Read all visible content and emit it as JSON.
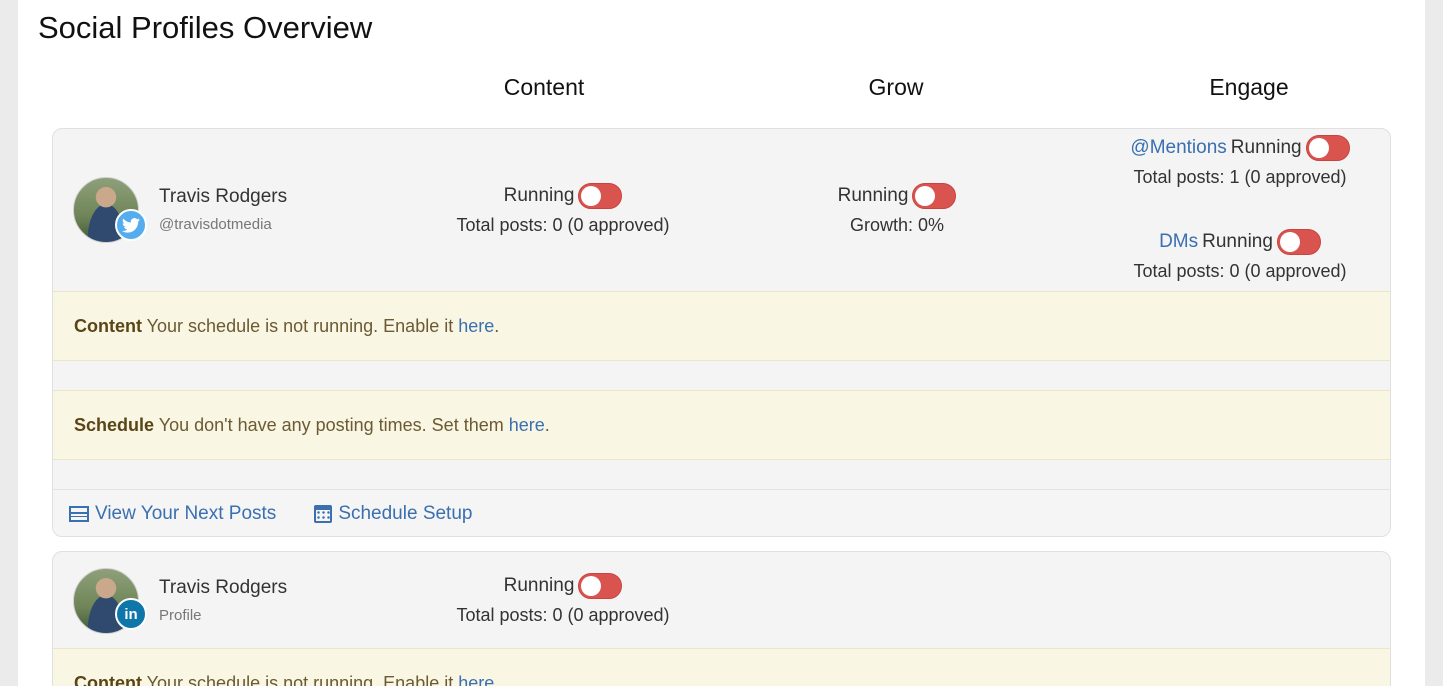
{
  "page": {
    "title": "Social Profiles Overview"
  },
  "columns": {
    "content": "Content",
    "grow": "Grow",
    "engage": "Engage"
  },
  "profiles": [
    {
      "name": "Travis Rodgers",
      "handle": "@travisdotmedia",
      "network_icon": "twitter-icon",
      "content": {
        "status": "Running",
        "posts": "Total posts: 0 (0 approved)"
      },
      "grow": {
        "status": "Running",
        "growth": "Growth: 0%"
      },
      "engage": {
        "mentions_link": "@Mentions",
        "mentions_status": "Running",
        "mentions_posts": "Total posts: 1 (0 approved)",
        "dms_link": "DMs",
        "dms_status": "Running",
        "dms_posts": "Total posts: 0 (0 approved)"
      },
      "alerts": [
        {
          "title": "Content",
          "text": "Your schedule is not running. Enable it",
          "link": "here",
          "end": "."
        },
        {
          "title": "Schedule",
          "text": "You don't have any posting times. Set them",
          "link": "here",
          "end": "."
        }
      ],
      "links": {
        "next_posts": "View Your Next Posts",
        "schedule_setup": "Schedule Setup"
      }
    },
    {
      "name": "Travis Rodgers",
      "handle": "Profile",
      "network_icon": "linkedin-icon",
      "content": {
        "status": "Running",
        "posts": "Total posts: 0 (0 approved)"
      },
      "alerts": [
        {
          "title": "Content",
          "text": "Your schedule is not running. Enable it",
          "link": "here",
          "end": "."
        }
      ]
    }
  ],
  "colors": {
    "toggle_off": "#d9534f",
    "link": "#3a6fb0",
    "alert_bg": "#f9f6e3"
  }
}
